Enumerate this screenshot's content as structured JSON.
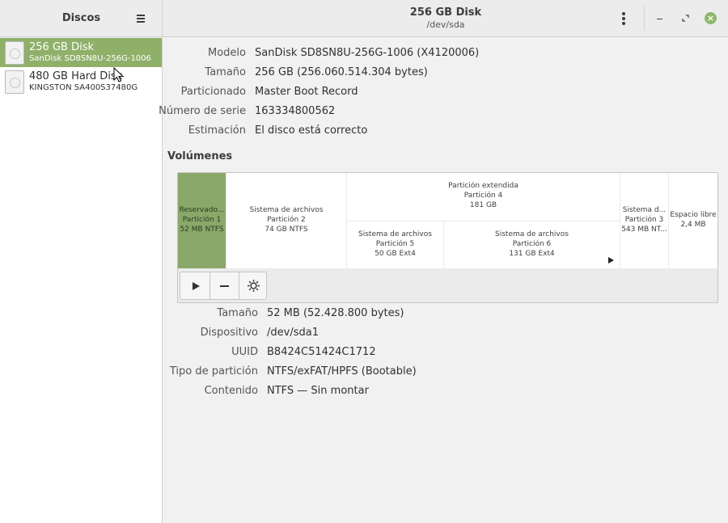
{
  "sidebar": {
    "title": "Discos",
    "disks": [
      {
        "name": "256 GB Disk",
        "model": "SanDisk SD8SN8U-256G-1006",
        "selected": true
      },
      {
        "name": "480 GB Hard Disk",
        "model": "KINGSTON SA400S37480G",
        "selected": false
      }
    ]
  },
  "header": {
    "title": "256 GB Disk",
    "subtitle": "/dev/sda"
  },
  "disk_info": [
    {
      "label": "Modelo",
      "value": "SanDisk SD8SN8U-256G-1006 (X4120006)"
    },
    {
      "label": "Tamaño",
      "value": "256 GB (256.060.514.304 bytes)"
    },
    {
      "label": "Particionado",
      "value": "Master Boot Record"
    },
    {
      "label": "Número de serie",
      "value": "163334800562"
    },
    {
      "label": "Estimación",
      "value": "El disco está correcto"
    }
  ],
  "volumes": {
    "title": "Volúmenes",
    "partitions": [
      {
        "lines": [
          "Reservado...",
          "Partición 1",
          "52 MB NTFS"
        ],
        "selected": true
      },
      {
        "lines": [
          "Sistema de archivos",
          "Partición 2",
          "74 GB NTFS"
        ]
      },
      {
        "lines": [
          "Partición extendida",
          "Partición 4",
          "181 GB"
        ]
      },
      {
        "lines": [
          "Sistema de archivos",
          "Partición 5",
          "50 GB Ext4"
        ]
      },
      {
        "lines": [
          "Sistema de archivos",
          "Partición 6",
          "131 GB Ext4"
        ]
      },
      {
        "lines": [
          "Sistema d...",
          "Partición 3",
          "543 MB NT..."
        ]
      },
      {
        "lines": [
          "Espacio libre",
          "2,4 MB"
        ]
      }
    ]
  },
  "partition_info": [
    {
      "label": "Tamaño",
      "value": "52 MB (52.428.800 bytes)"
    },
    {
      "label": "Dispositivo",
      "value": "/dev/sda1"
    },
    {
      "label": "UUID",
      "value": "B8424C51424C1712"
    },
    {
      "label": "Tipo de partición",
      "value": "NTFS/exFAT/HPFS (Bootable)"
    },
    {
      "label": "Contenido",
      "value": "NTFS — Sin montar"
    }
  ],
  "colors": {
    "accent": "#8fb069",
    "selected_partition": "#8aa86a",
    "close_button": "#8fb86c"
  },
  "icons": {
    "hamburger": "menu-icon",
    "kebab": "more-options-icon",
    "play": "mount-icon",
    "minus": "remove-partition-icon",
    "gear": "settings-gear-icon"
  }
}
